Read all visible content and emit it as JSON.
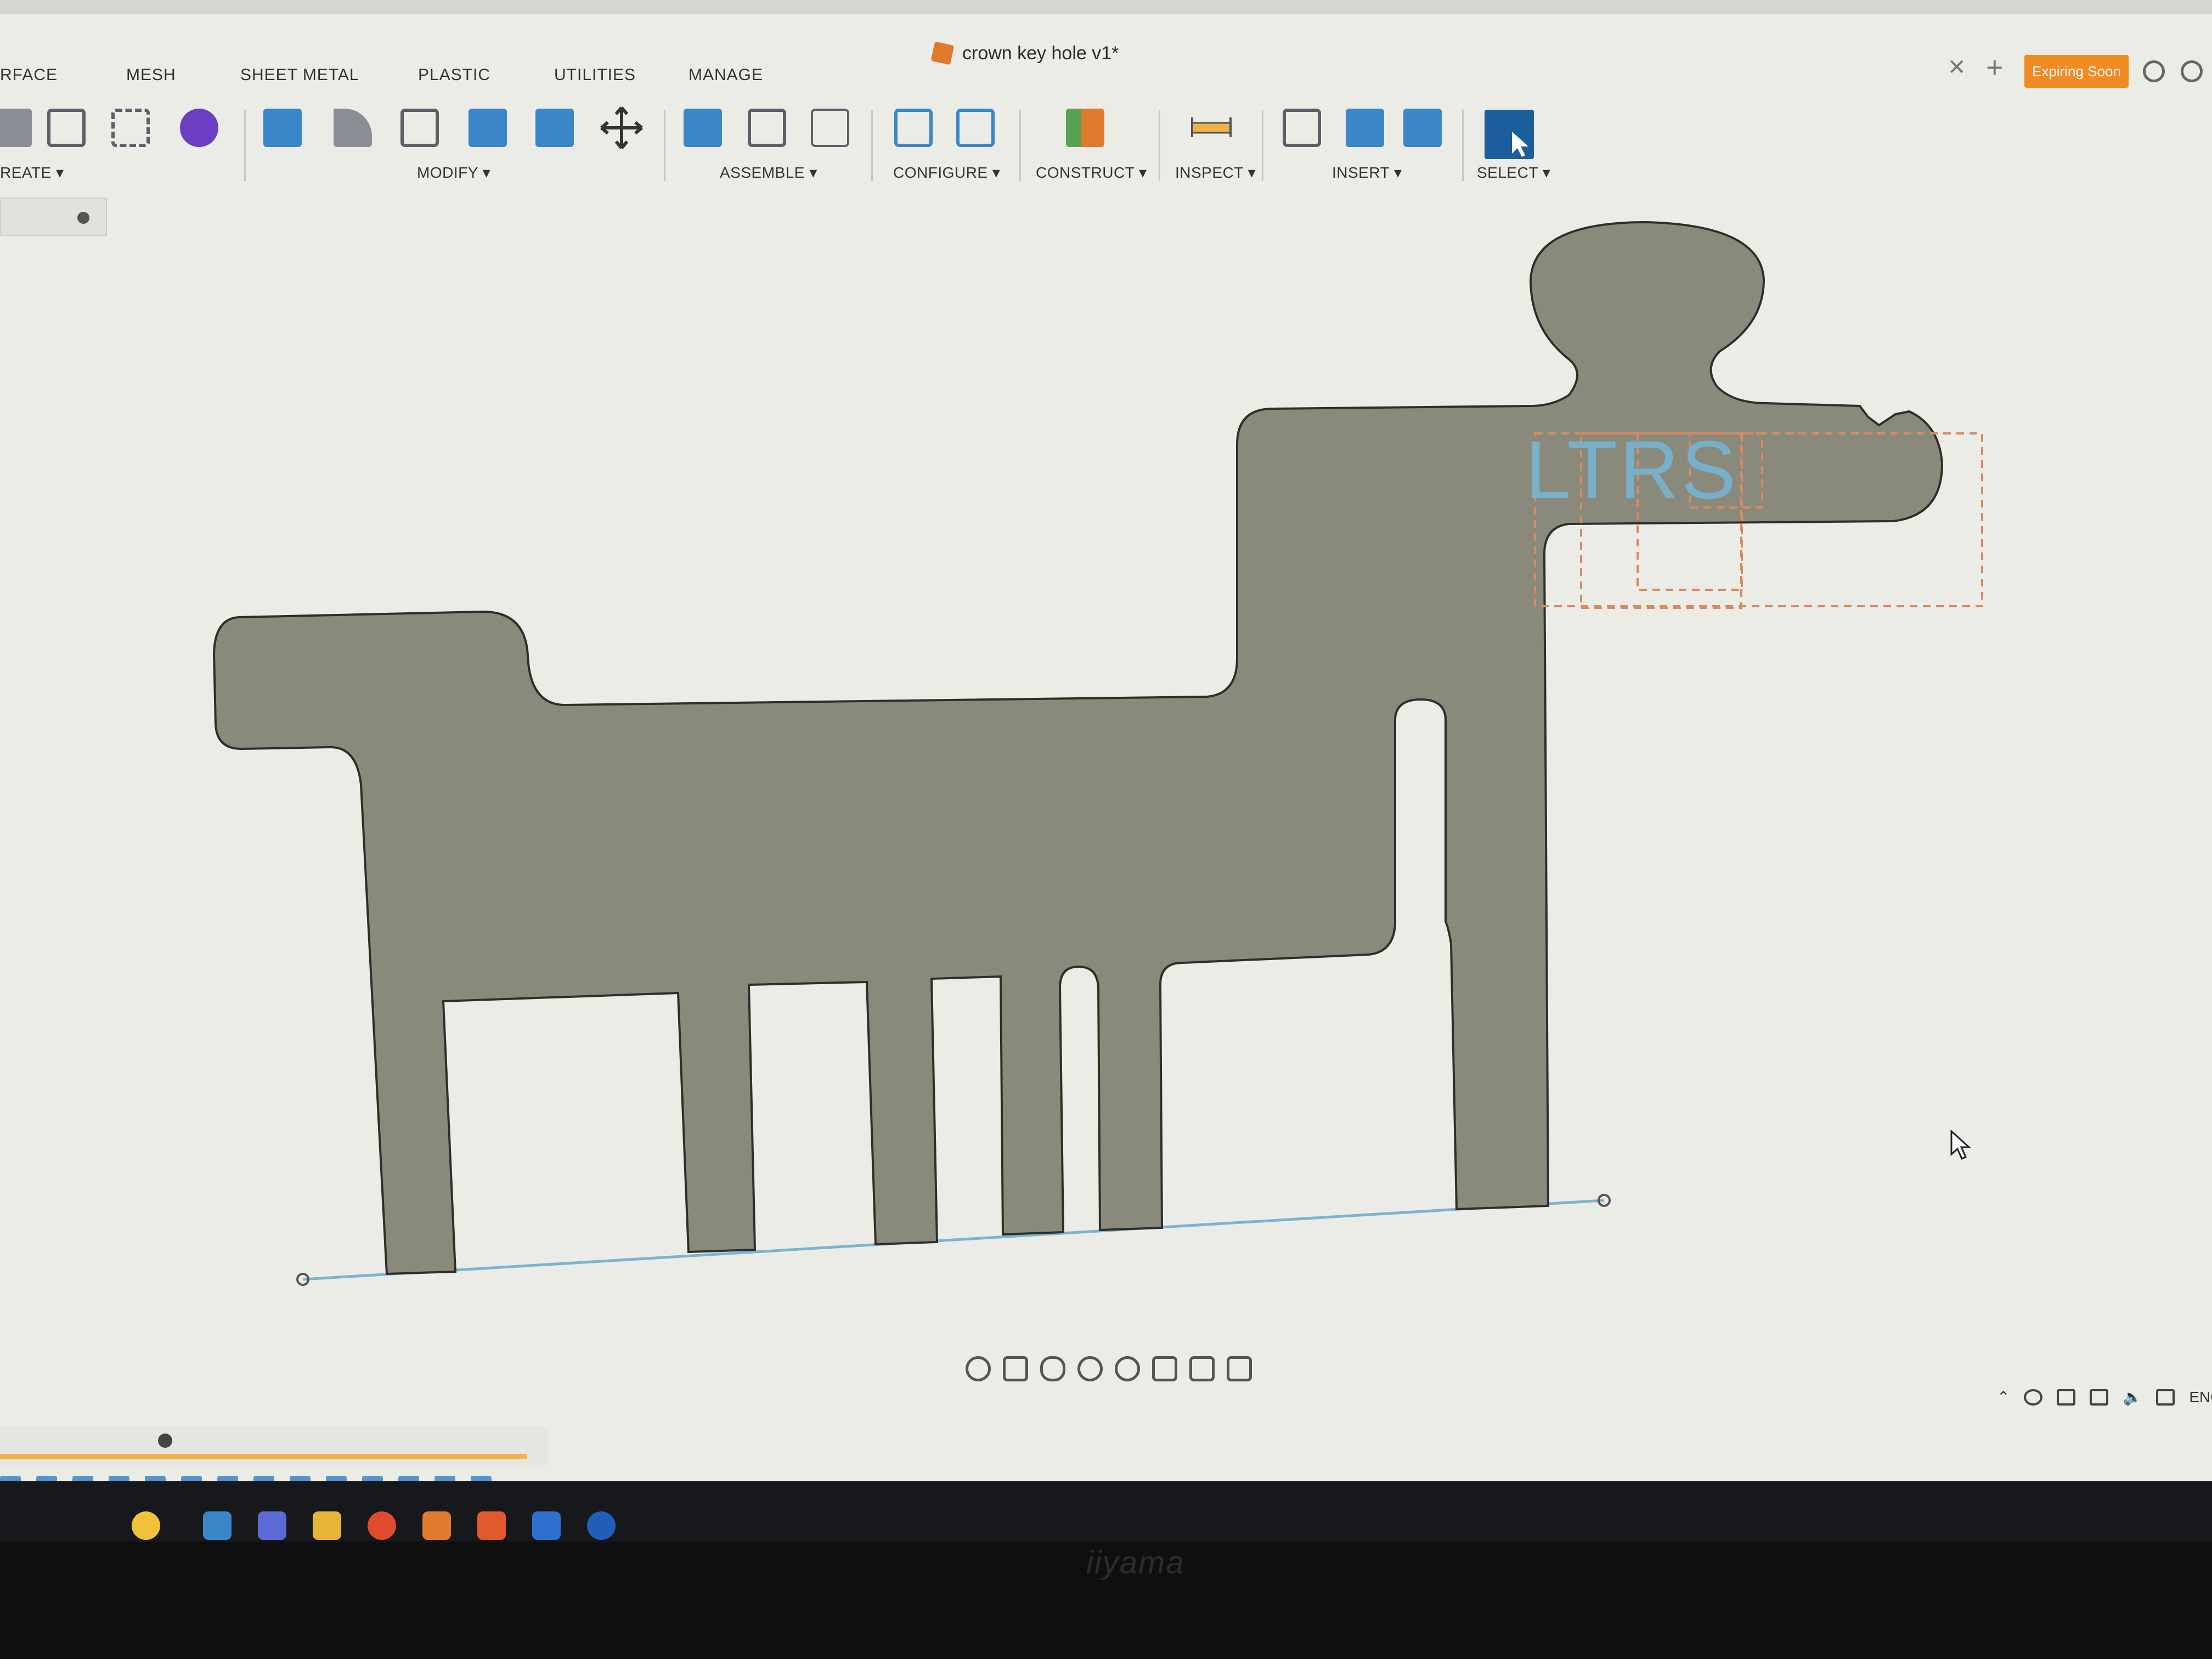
{
  "window": {
    "document_title": "crown key hole v1*",
    "expiring_badge": "Expiring Soon"
  },
  "ribbon": {
    "tabs": [
      "RFACE",
      "MESH",
      "SHEET METAL",
      "PLASTIC",
      "UTILITIES",
      "MANAGE"
    ],
    "groups": {
      "create": "REATE ▾",
      "modify": "MODIFY ▾",
      "assemble": "ASSEMBLE ▾",
      "configure": "CONFIGURE ▾",
      "construct": "CONSTRUCT ▾",
      "inspect": "INSPECT ▾",
      "insert": "INSERT ▾",
      "select": "SELECT ▾"
    }
  },
  "canvas": {
    "sketch_text": "LTRS",
    "body_color": "#8a8a7c",
    "background_color": "#ecece6",
    "text_color": "#74b6d8",
    "dashed_color": "#d88a62",
    "line_color": "#7cb3d0"
  },
  "tray": {
    "language": "ENG"
  },
  "bezel": {
    "brand": "iiyama"
  },
  "icons": {
    "expiring": "clock-icon",
    "help": "help-icon",
    "select": "select-cursor-icon",
    "cursor": "mouse-pointer-icon"
  }
}
